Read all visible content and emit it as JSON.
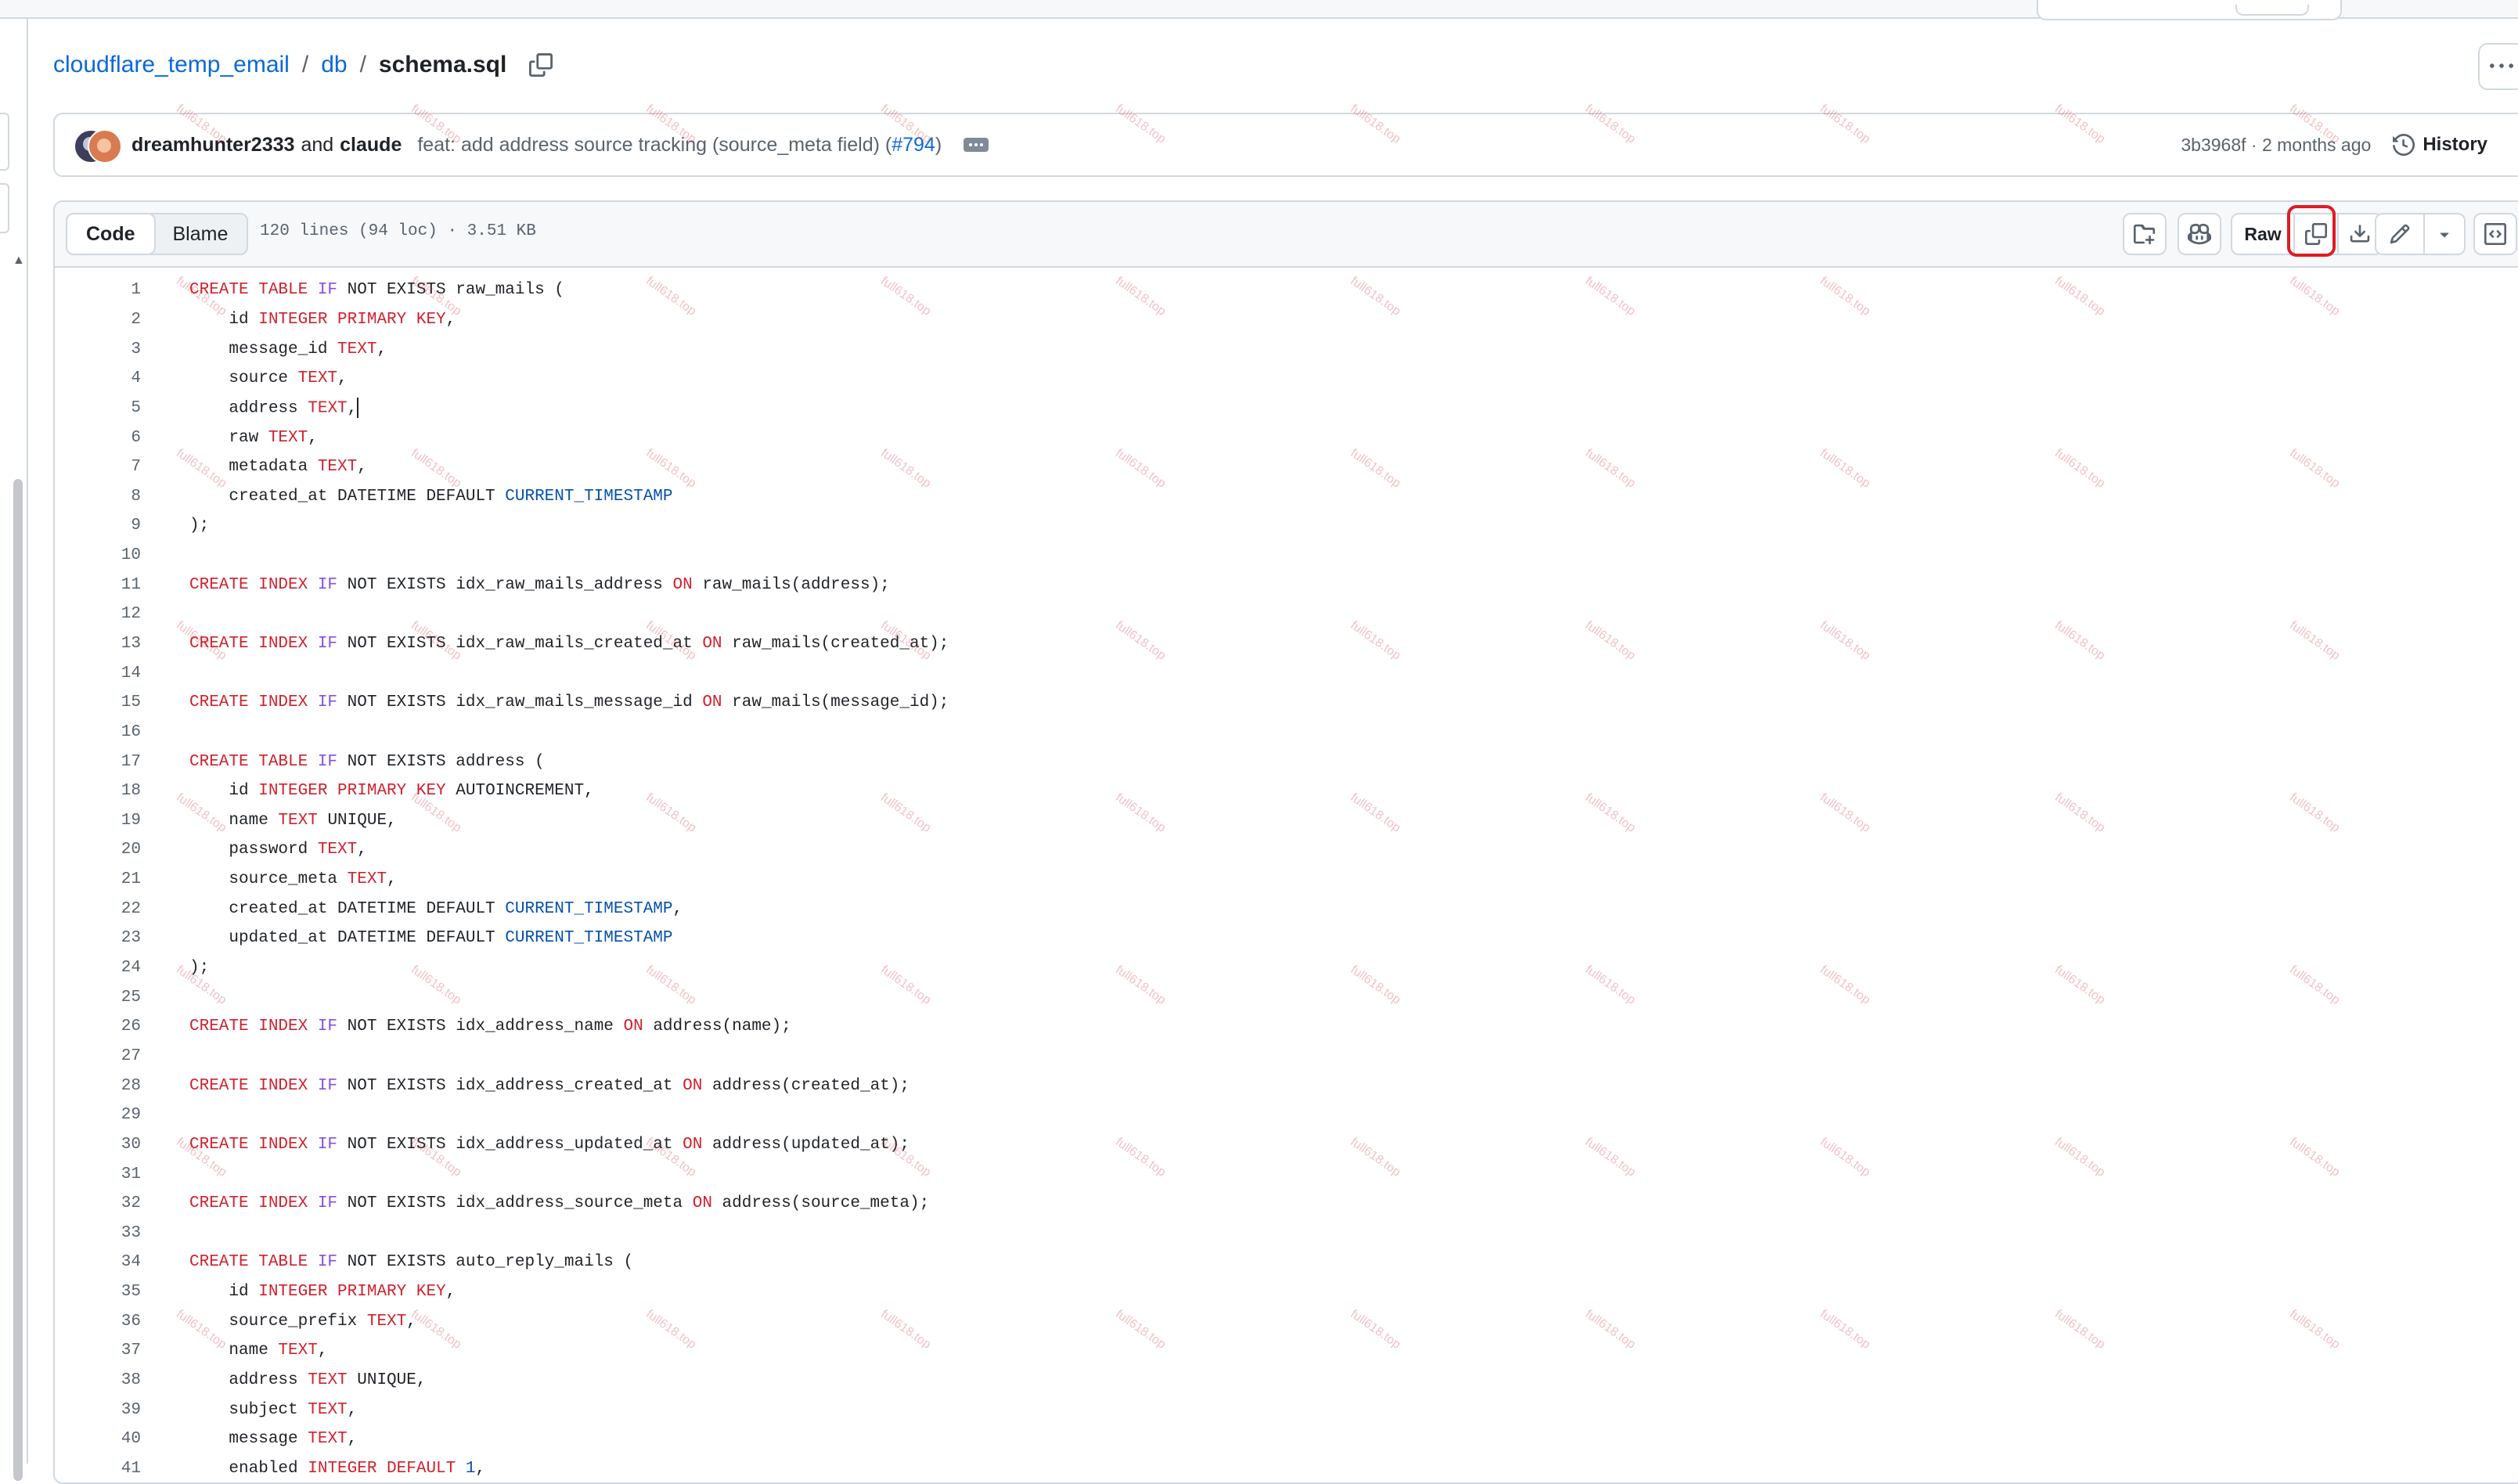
{
  "breadcrumb": {
    "repo": "cloudflare_temp_email",
    "folder": "db",
    "file": "schema.sql",
    "separator": "/"
  },
  "commit": {
    "author1": "dreamhunter2333",
    "and": "and",
    "author2": "claude",
    "message": "feat: add address source tracking (source_meta field) (",
    "pr": "#794",
    "message_end": ")",
    "meta": "3b3968f · 2 months ago",
    "history_label": "History"
  },
  "file_header": {
    "code_tab": "Code",
    "blame_tab": "Blame",
    "info": "120 lines (94 loc) · 3.51 KB",
    "raw_label": "Raw"
  },
  "watermark": "full618.top",
  "code_lines": [
    [
      [
        "k",
        "CREATE TABLE "
      ],
      [
        "p",
        "IF "
      ],
      [
        "t",
        "NOT EXISTS raw_mails ("
      ]
    ],
    [
      [
        "t",
        "    id "
      ],
      [
        "k",
        "INTEGER PRIMARY KEY"
      ],
      [
        "t",
        ","
      ]
    ],
    [
      [
        "t",
        "    message_id "
      ],
      [
        "k",
        "TEXT"
      ],
      [
        "t",
        ","
      ]
    ],
    [
      [
        "t",
        "    source "
      ],
      [
        "k",
        "TEXT"
      ],
      [
        "t",
        ","
      ]
    ],
    [
      [
        "t",
        "    address "
      ],
      [
        "k",
        "TEXT"
      ],
      [
        "t",
        ","
      ],
      [
        "caret",
        ""
      ]
    ],
    [
      [
        "t",
        "    raw "
      ],
      [
        "k",
        "TEXT"
      ],
      [
        "t",
        ","
      ]
    ],
    [
      [
        "t",
        "    metadata "
      ],
      [
        "k",
        "TEXT"
      ],
      [
        "t",
        ","
      ]
    ],
    [
      [
        "t",
        "    created_at DATETIME DEFAULT "
      ],
      [
        "c",
        "CURRENT_TIMESTAMP"
      ]
    ],
    [
      [
        "t",
        ");"
      ]
    ],
    [],
    [
      [
        "k",
        "CREATE INDEX "
      ],
      [
        "p",
        "IF "
      ],
      [
        "t",
        "NOT EXISTS idx_raw_mails_address "
      ],
      [
        "k",
        "ON "
      ],
      [
        "t",
        "raw_mails(address);"
      ]
    ],
    [],
    [
      [
        "k",
        "CREATE INDEX "
      ],
      [
        "p",
        "IF "
      ],
      [
        "t",
        "NOT EXISTS idx_raw_mails_created_at "
      ],
      [
        "k",
        "ON "
      ],
      [
        "t",
        "raw_mails(created_at);"
      ]
    ],
    [],
    [
      [
        "k",
        "CREATE INDEX "
      ],
      [
        "p",
        "IF "
      ],
      [
        "t",
        "NOT EXISTS idx_raw_mails_message_id "
      ],
      [
        "k",
        "ON "
      ],
      [
        "t",
        "raw_mails(message_id);"
      ]
    ],
    [],
    [
      [
        "k",
        "CREATE TABLE "
      ],
      [
        "p",
        "IF "
      ],
      [
        "t",
        "NOT EXISTS address ("
      ]
    ],
    [
      [
        "t",
        "    id "
      ],
      [
        "k",
        "INTEGER PRIMARY KEY "
      ],
      [
        "t",
        "AUTOINCREMENT,"
      ]
    ],
    [
      [
        "t",
        "    name "
      ],
      [
        "k",
        "TEXT "
      ],
      [
        "t",
        "UNIQUE,"
      ]
    ],
    [
      [
        "t",
        "    password "
      ],
      [
        "k",
        "TEXT"
      ],
      [
        "t",
        ","
      ]
    ],
    [
      [
        "t",
        "    source_meta "
      ],
      [
        "k",
        "TEXT"
      ],
      [
        "t",
        ","
      ]
    ],
    [
      [
        "t",
        "    created_at DATETIME DEFAULT "
      ],
      [
        "c",
        "CURRENT_TIMESTAMP"
      ],
      [
        "t",
        ","
      ]
    ],
    [
      [
        "t",
        "    updated_at DATETIME DEFAULT "
      ],
      [
        "c",
        "CURRENT_TIMESTAMP"
      ]
    ],
    [
      [
        "t",
        ");"
      ]
    ],
    [],
    [
      [
        "k",
        "CREATE INDEX "
      ],
      [
        "p",
        "IF "
      ],
      [
        "t",
        "NOT EXISTS idx_address_name "
      ],
      [
        "k",
        "ON "
      ],
      [
        "t",
        "address(name);"
      ]
    ],
    [],
    [
      [
        "k",
        "CREATE INDEX "
      ],
      [
        "p",
        "IF "
      ],
      [
        "t",
        "NOT EXISTS idx_address_created_at "
      ],
      [
        "k",
        "ON "
      ],
      [
        "t",
        "address(created_at);"
      ]
    ],
    [],
    [
      [
        "k",
        "CREATE INDEX "
      ],
      [
        "p",
        "IF "
      ],
      [
        "t",
        "NOT EXISTS idx_address_updated_at "
      ],
      [
        "k",
        "ON "
      ],
      [
        "t",
        "address(updated_at);"
      ]
    ],
    [],
    [
      [
        "k",
        "CREATE INDEX "
      ],
      [
        "p",
        "IF "
      ],
      [
        "t",
        "NOT EXISTS idx_address_source_meta "
      ],
      [
        "k",
        "ON "
      ],
      [
        "t",
        "address(source_meta);"
      ]
    ],
    [],
    [
      [
        "k",
        "CREATE TABLE "
      ],
      [
        "p",
        "IF "
      ],
      [
        "t",
        "NOT EXISTS auto_reply_mails ("
      ]
    ],
    [
      [
        "t",
        "    id "
      ],
      [
        "k",
        "INTEGER PRIMARY KEY"
      ],
      [
        "t",
        ","
      ]
    ],
    [
      [
        "t",
        "    source_prefix "
      ],
      [
        "k",
        "TEXT"
      ],
      [
        "t",
        ","
      ]
    ],
    [
      [
        "t",
        "    name "
      ],
      [
        "k",
        "TEXT"
      ],
      [
        "t",
        ","
      ]
    ],
    [
      [
        "t",
        "    address "
      ],
      [
        "k",
        "TEXT "
      ],
      [
        "t",
        "UNIQUE,"
      ]
    ],
    [
      [
        "t",
        "    subject "
      ],
      [
        "k",
        "TEXT"
      ],
      [
        "t",
        ","
      ]
    ],
    [
      [
        "t",
        "    message "
      ],
      [
        "k",
        "TEXT"
      ],
      [
        "t",
        ","
      ]
    ],
    [
      [
        "t",
        "    enabled "
      ],
      [
        "k",
        "INTEGER DEFAULT "
      ],
      [
        "c",
        "1"
      ],
      [
        "t",
        ","
      ]
    ]
  ]
}
